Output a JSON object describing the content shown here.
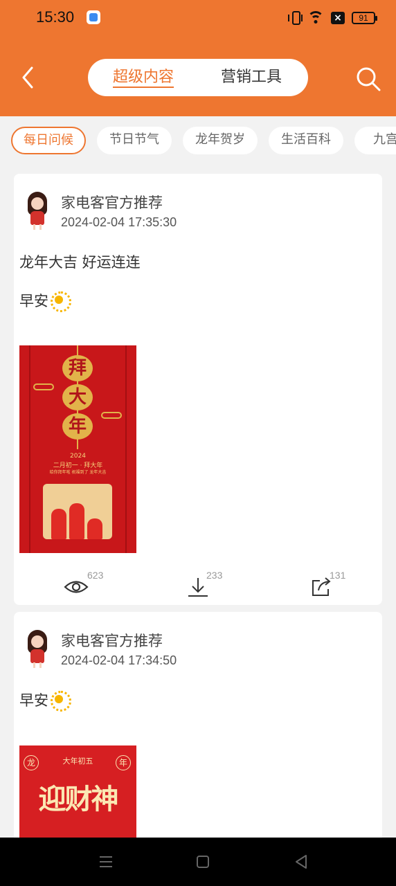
{
  "status_bar": {
    "time": "15:30",
    "battery": "91"
  },
  "header": {
    "tabs": [
      {
        "label": "超级内容",
        "active": true
      },
      {
        "label": "营销工具",
        "active": false
      }
    ],
    "accent": "#ee7630"
  },
  "categories": [
    {
      "label": "每日问候",
      "active": true
    },
    {
      "label": "节日节气",
      "active": false
    },
    {
      "label": "龙年贺岁",
      "active": false
    },
    {
      "label": "生活百科",
      "active": false
    },
    {
      "label": "九宫格",
      "active": false
    }
  ],
  "posts": [
    {
      "author": "家电客官方推荐",
      "time": "2024-02-04 17:35:30",
      "lines": [
        "龙年大吉 好运连连",
        "早安"
      ],
      "poster": {
        "lantern_chars": [
          "拜",
          "大",
          "年"
        ],
        "year": "2024",
        "caption": "二月初一 · 拜大年",
        "subcaption": "给你拜年啦 祝福到了 龙年大吉"
      },
      "stats": {
        "views": "623",
        "downloads": "233",
        "shares": "131"
      }
    },
    {
      "author": "家电客官方推荐",
      "time": "2024-02-04 17:34:50",
      "lines": [
        "早安"
      ],
      "poster": {
        "top_text": "大年初五",
        "title": "迎财神",
        "corner_left": "龙",
        "corner_right": "年"
      }
    }
  ]
}
